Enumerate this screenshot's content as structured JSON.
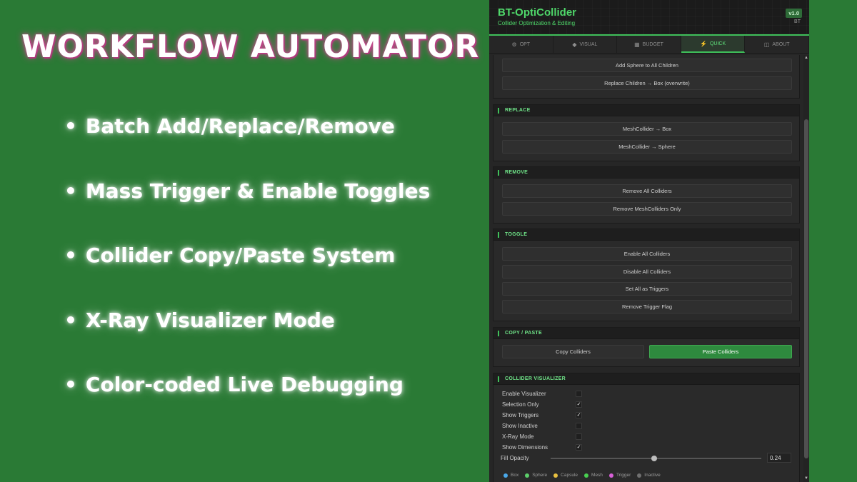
{
  "promo": {
    "title": "WORKFLOW AUTOMATOR",
    "features": [
      "Batch Add/Replace/Remove",
      "Mass Trigger & Enable Toggles",
      "Collider Copy/Paste System",
      "X-Ray Visualizer Mode",
      "Color-coded Live Debugging"
    ],
    "bullet": "•"
  },
  "header": {
    "title": "BT-OptiCollider",
    "subtitle": "Collider Optimization & Editing",
    "version": "v1.0",
    "author": "BT"
  },
  "tabs": [
    {
      "label": "OPT",
      "icon": "⚙",
      "icon_name": "gear-icon"
    },
    {
      "label": "VISUAL",
      "icon": "◆",
      "icon_name": "diamond-icon"
    },
    {
      "label": "BUDGET",
      "icon": "▦",
      "icon_name": "grid-icon"
    },
    {
      "label": "QUICK",
      "icon": "⚡",
      "icon_name": "lightning-icon",
      "active": true
    },
    {
      "label": "ABOUT",
      "icon": "◫",
      "icon_name": "book-icon"
    }
  ],
  "add_section": {
    "buttons": [
      "Add Sphere to All Children",
      "Replace Children → Box (overwrite)"
    ]
  },
  "replace_section": {
    "label": "REPLACE",
    "buttons": [
      "MeshCollider → Box",
      "MeshCollider → Sphere"
    ]
  },
  "remove_section": {
    "label": "REMOVE",
    "buttons": [
      "Remove All Colliders",
      "Remove MeshColliders Only"
    ]
  },
  "toggle_section": {
    "label": "TOGGLE",
    "buttons": [
      "Enable All Colliders",
      "Disable All Colliders",
      "Set All as Triggers",
      "Remove Trigger Flag"
    ]
  },
  "copy_section": {
    "label": "COPY / PASTE",
    "copy_label": "Copy Colliders",
    "paste_label": "Paste Colliders"
  },
  "visualizer_section": {
    "label": "COLLIDER VISUALIZER",
    "options": [
      {
        "label": "Enable Visualizer",
        "checked": false
      },
      {
        "label": "Selection Only",
        "checked": true
      },
      {
        "label": "Show Triggers",
        "checked": true
      },
      {
        "label": "Show Inactive",
        "checked": false
      },
      {
        "label": "X-Ray Mode",
        "checked": false
      },
      {
        "label": "Show Dimensions",
        "checked": true
      }
    ],
    "fill_opacity_label": "Fill Opacity",
    "fill_opacity_value": "0.24",
    "fill_opacity_fraction": 0.24,
    "legend": [
      {
        "label": "Box",
        "color": "#4aa8e8"
      },
      {
        "label": "Sphere",
        "color": "#5ccf6a"
      },
      {
        "label": "Capsule",
        "color": "#e8c040"
      },
      {
        "label": "Mesh",
        "color": "#48d050"
      },
      {
        "label": "Trigger",
        "color": "#d860d8"
      },
      {
        "label": "Inactive",
        "color": "#707070"
      }
    ]
  },
  "colors": {
    "accent": "#3fc05a",
    "background": "#2a7a35",
    "title_glow": "#c24b8c"
  }
}
